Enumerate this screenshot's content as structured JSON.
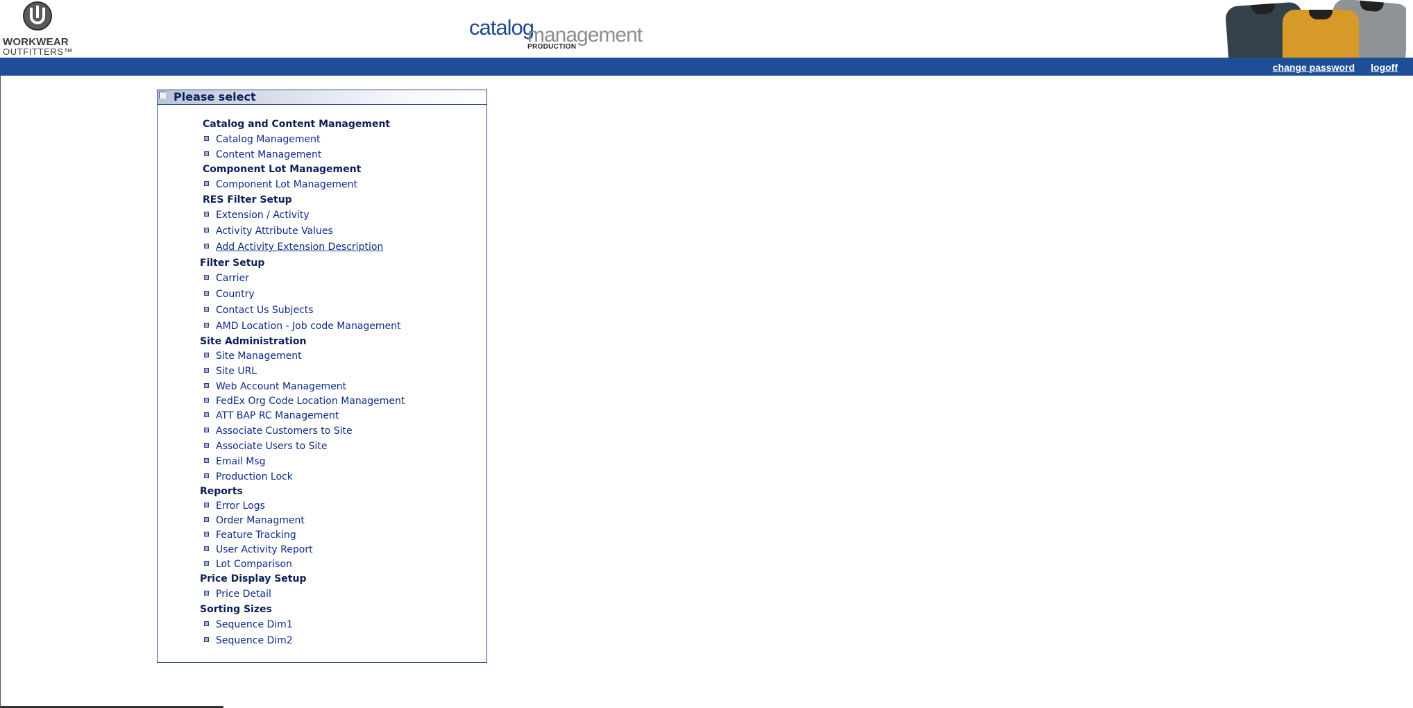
{
  "header": {
    "logo_line1": "WORKWEAR",
    "logo_line2": "OUTFITTERS™",
    "brand_catalog": "catalog",
    "brand_management": "management",
    "brand_environment": "PRODUCTION"
  },
  "nav": {
    "change_password": "change password",
    "logoff": "logoff"
  },
  "panel": {
    "title": "Please select"
  },
  "menu": {
    "sections": [
      {
        "title": "Catalog and Content Management",
        "items": [
          "Catalog Management",
          "Content Management"
        ]
      },
      {
        "title": "Component Lot Management",
        "items": [
          "Component Lot Management"
        ]
      },
      {
        "title": "RES Filter Setup",
        "items": [
          "Extension / Activity",
          "Activity Attribute Values",
          "Add Activity Extension Description"
        ]
      },
      {
        "title": "Filter Setup",
        "items": [
          "Carrier",
          "Country",
          "Contact Us Subjects",
          "AMD Location - Job code Management"
        ]
      },
      {
        "title": "Site Administration",
        "items": [
          "Site Management",
          "Site URL",
          "Web Account Management",
          "FedEx Org Code Location Management",
          "ATT BAP RC Management",
          "Associate Customers to Site",
          "Associate Users to Site",
          "Email Msg",
          "Production Lock"
        ]
      },
      {
        "title": "Reports",
        "items": [
          "Error Logs",
          "Order Managment",
          "Feature Tracking",
          "User Activity Report",
          "Lot Comparison"
        ]
      },
      {
        "title": "Price Display Setup",
        "items": [
          "Price Detail"
        ]
      },
      {
        "title": "Sorting Sizes",
        "items": [
          "Sequence Dim1",
          "Sequence Dim2"
        ]
      }
    ]
  },
  "colors": {
    "navbar": "#1f4e98",
    "link": "#0b2a8a",
    "panel_border": "#2c4a8a"
  },
  "icons": [
    "workwear-logo-icon",
    "garments-banner-image",
    "square-bullet-icon"
  ]
}
